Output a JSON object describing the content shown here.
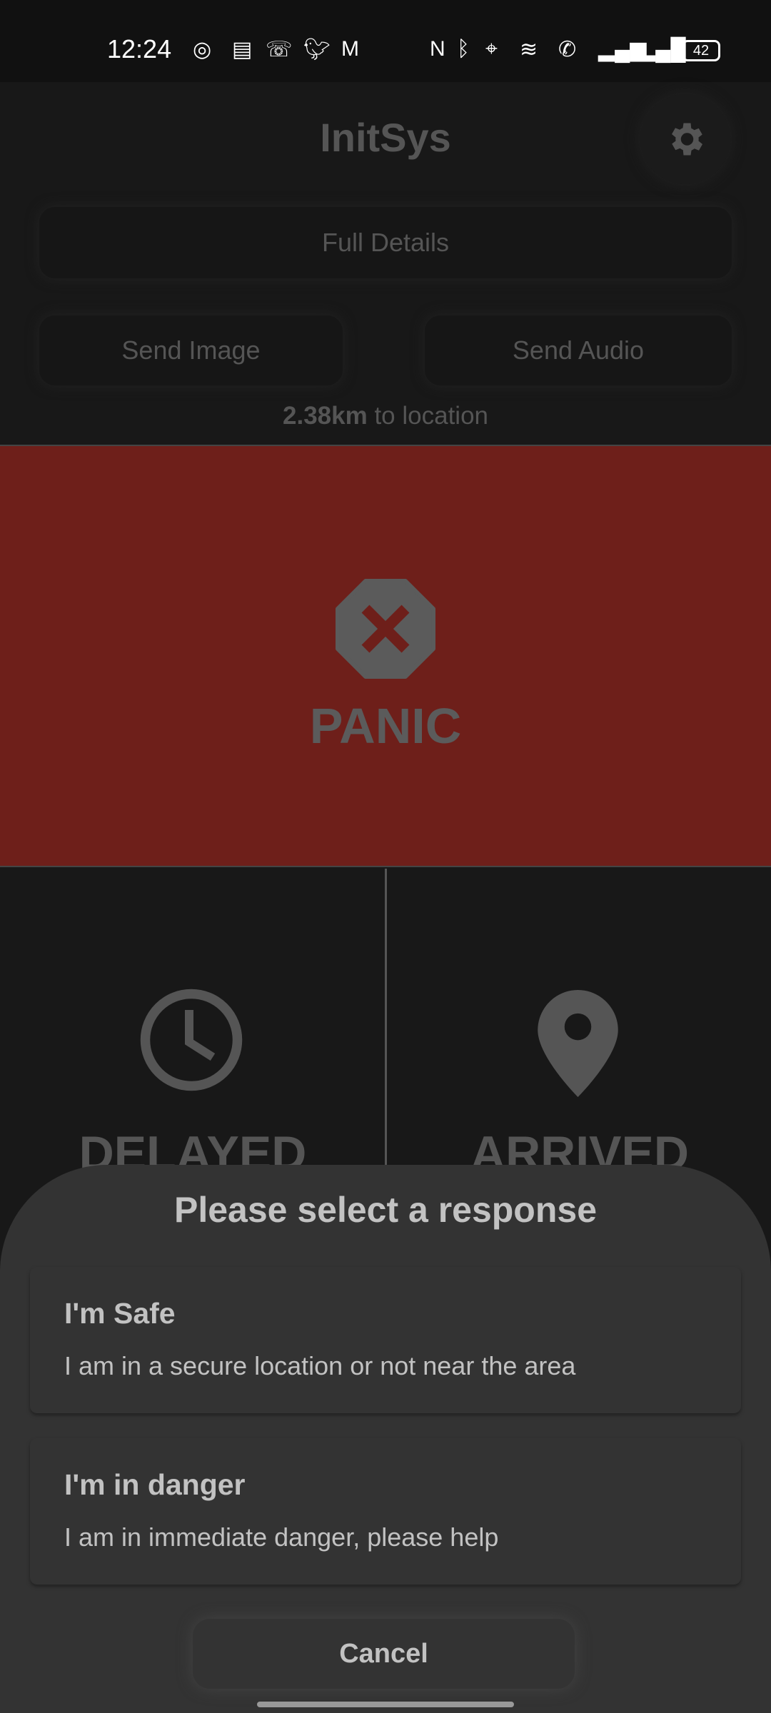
{
  "status_bar": {
    "time": "12:24",
    "battery": "42",
    "left_icons": [
      "whatsapp-icon",
      "news-icon",
      "missed-call-icon",
      "twitter-icon",
      "gmail-icon"
    ],
    "right_icons": [
      "nfc-icon",
      "bluetooth-icon",
      "location-icon",
      "wifi-icon",
      "wifi-calling-icon",
      "signal-icon",
      "signal-icon"
    ]
  },
  "header": {
    "title": "InitSys",
    "settings_icon": "gear-icon"
  },
  "actions": {
    "full_details": "Full Details",
    "send_image": "Send Image",
    "send_audio": "Send Audio"
  },
  "distance": {
    "value": "2.38km",
    "suffix": " to location"
  },
  "panic": {
    "label": "PANIC",
    "icon": "stop-x-icon",
    "color": "#6e1f1a"
  },
  "delayed": {
    "label": "DELAYED",
    "icon": "clock-icon"
  },
  "arrived": {
    "label": "ARRIVED",
    "icon": "location-pin-icon"
  },
  "sheet": {
    "title": "Please select a response",
    "options": [
      {
        "title": "I'm Safe",
        "description": "I am in a secure location or not near the area"
      },
      {
        "title": "I'm in danger",
        "description": "I am in immediate danger, please help"
      }
    ],
    "cancel": "Cancel"
  }
}
